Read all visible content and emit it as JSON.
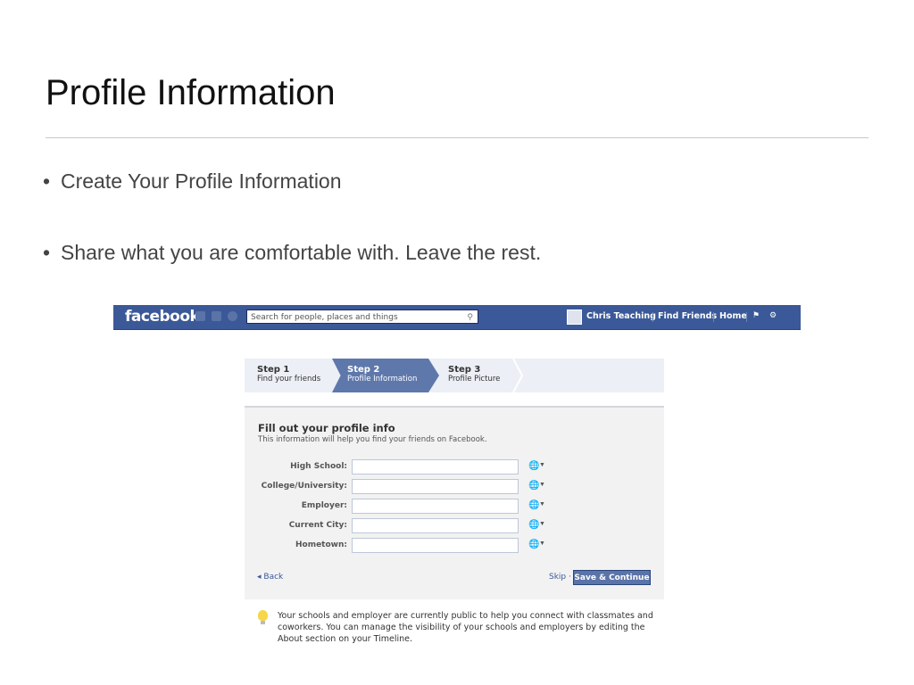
{
  "slide": {
    "title": "Profile Information",
    "bullets": [
      "Create Your Profile Information",
      "Share what you are comfortable with.  Leave the rest."
    ]
  },
  "facebook": {
    "logo": "facebook",
    "search_placeholder": "Search for people, places and things",
    "user_name": "Chris Teaching",
    "nav": {
      "find_friends": "Find Friends",
      "home": "Home"
    },
    "brand_color": "#3b5998"
  },
  "steps": [
    {
      "title": "Step 1",
      "subtitle": "Find your friends"
    },
    {
      "title": "Step 2",
      "subtitle": "Profile Information"
    },
    {
      "title": "Step 3",
      "subtitle": "Profile Picture"
    }
  ],
  "form": {
    "title": "Fill out your profile info",
    "subtitle": "This information will help you find your friends on Facebook.",
    "fields": [
      {
        "label": "High School:",
        "value": ""
      },
      {
        "label": "College/University:",
        "value": ""
      },
      {
        "label": "Employer:",
        "value": ""
      },
      {
        "label": "Current City:",
        "value": ""
      },
      {
        "label": "Hometown:",
        "value": ""
      }
    ],
    "back": "Back",
    "skip": "Skip",
    "save_continue": "Save & Continue"
  },
  "note": "Your schools and employer are currently public to help you connect with classmates and coworkers. You can manage the visibility of your schools and employers by editing the About section on your Timeline."
}
